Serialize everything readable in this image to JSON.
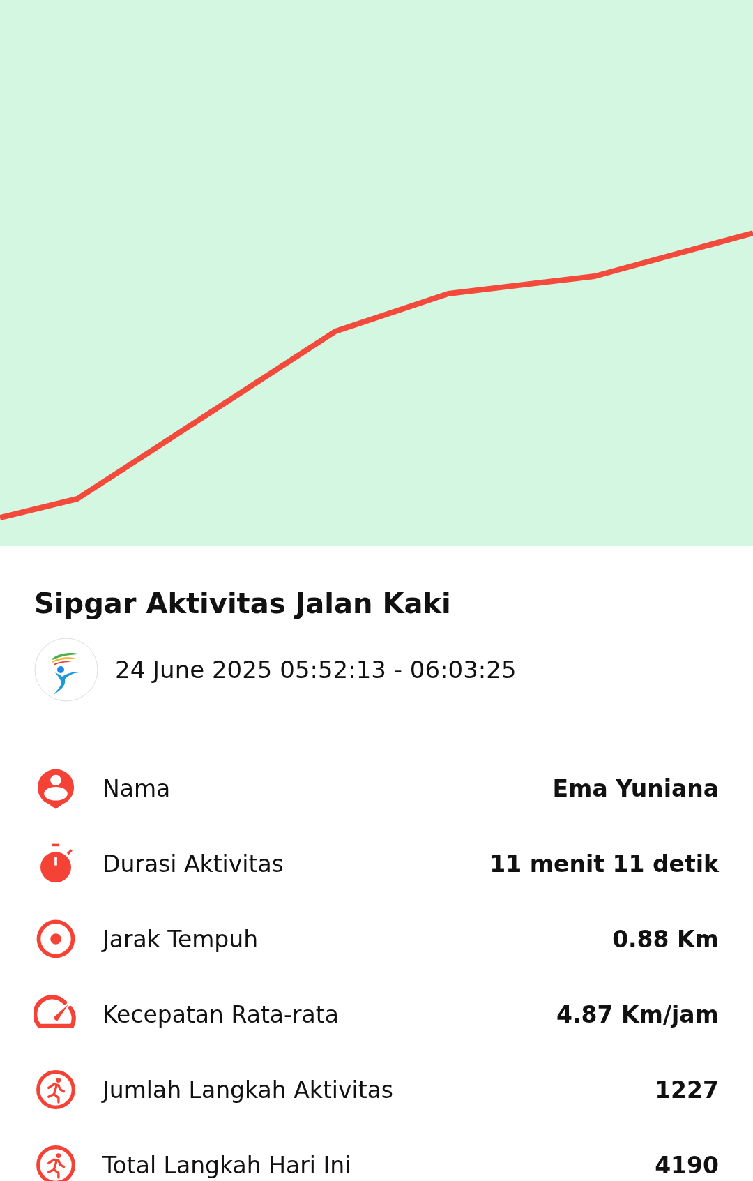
{
  "title": "Sipgar Aktivitas Jalan Kaki",
  "session": {
    "time_range": "24 June 2025 05:52:13 - 06:03:25"
  },
  "stats": [
    {
      "kind": "person",
      "label": "Nama",
      "value": "Ema Yuniana"
    },
    {
      "kind": "timer",
      "label": "Durasi Aktivitas",
      "value": "11 menit 11 detik"
    },
    {
      "kind": "target",
      "label": "Jarak Tempuh",
      "value": "0.88 Km"
    },
    {
      "kind": "speed",
      "label": "Kecepatan Rata-rata",
      "value": "4.87 Km/jam"
    },
    {
      "kind": "walk",
      "label": "Jumlah Langkah Aktivitas",
      "value": "1227"
    },
    {
      "kind": "walk",
      "label": "Total Langkah Hari Ini",
      "value": "4190"
    }
  ]
}
